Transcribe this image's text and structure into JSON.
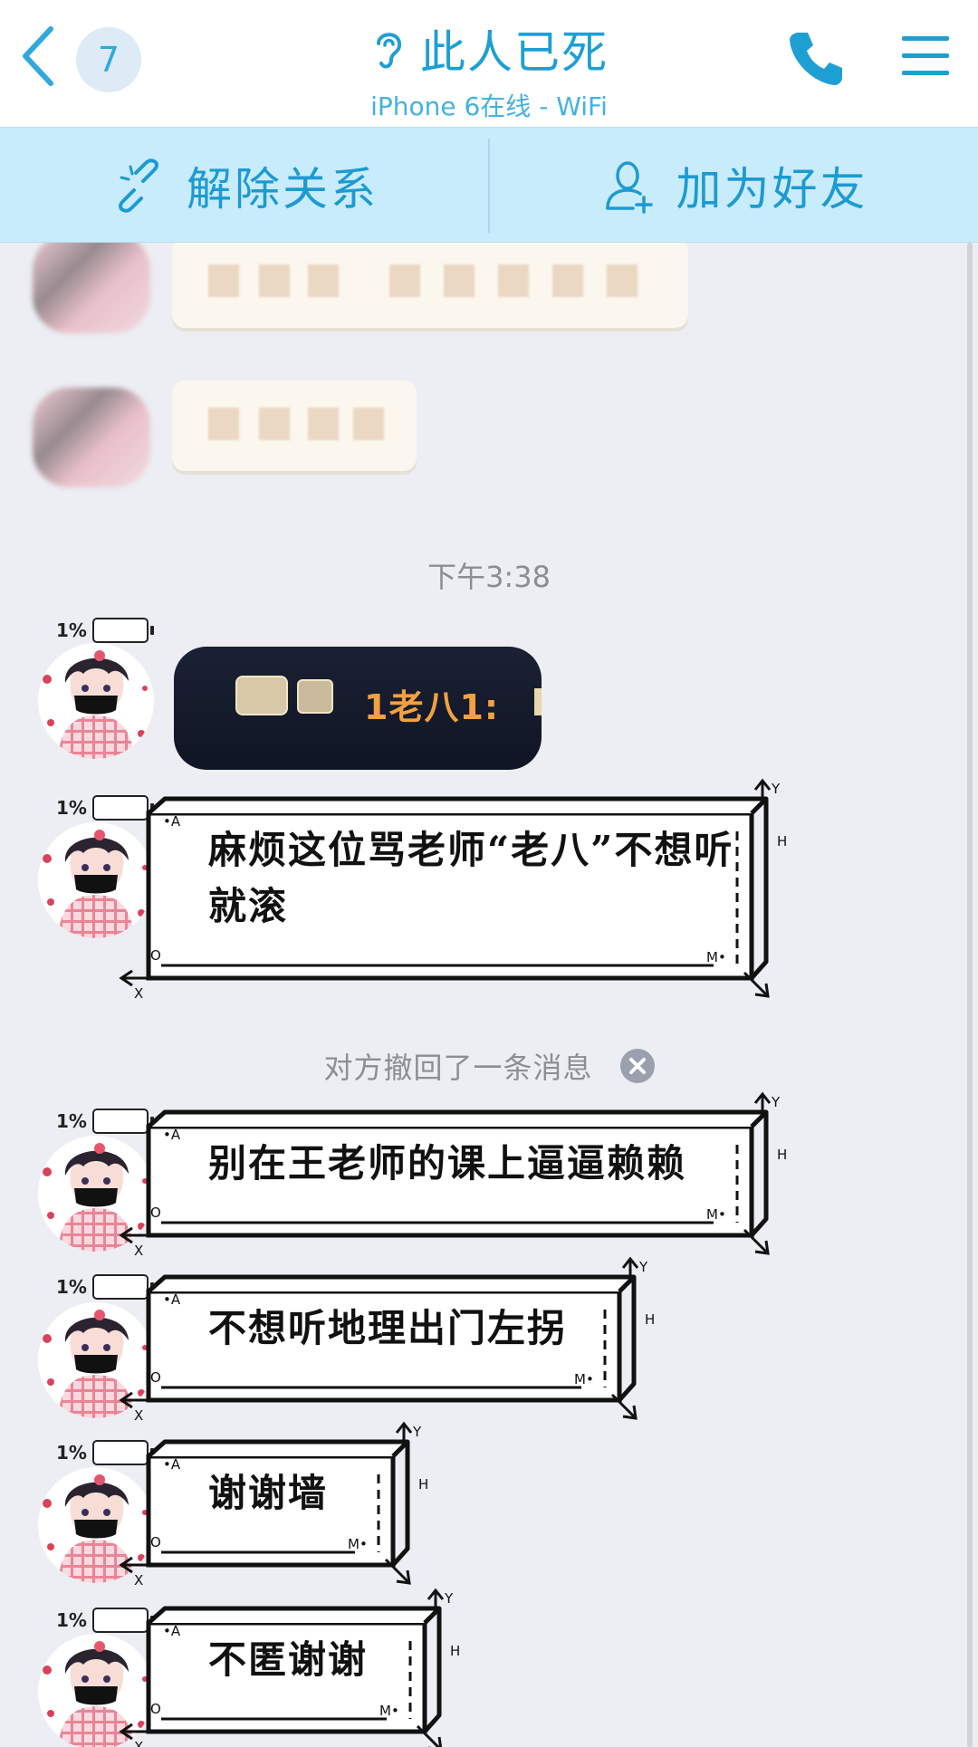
{
  "header": {
    "unread_count": "7",
    "title": "此人已死",
    "subtitle": "iPhone 6在线 - WiFi"
  },
  "actions": {
    "unlink_label": "解除关系",
    "add_friend_label": "加为好友"
  },
  "colors": {
    "accent": "#1e9fd4",
    "actionbar_bg": "#c8ecfb",
    "chat_bg": "#eceef3"
  },
  "chat": {
    "timestamp": "下午3:38",
    "battery_label": "1%",
    "image_message_text": "1老八1:",
    "messages": [
      {
        "text": "麻烦这位骂老师“老八”不想听就滚"
      },
      {
        "text": "别在王老师的课上逼逼赖赖"
      },
      {
        "text": "不想听地理出门左拐"
      },
      {
        "text": "谢谢墙"
      },
      {
        "text": "不匿谢谢"
      }
    ],
    "recall_notice": "对方撤回了一条消息",
    "box_axis_labels": {
      "a": "A",
      "o": "O",
      "x": "X",
      "y": "Y",
      "h": "H",
      "m": "M"
    }
  }
}
